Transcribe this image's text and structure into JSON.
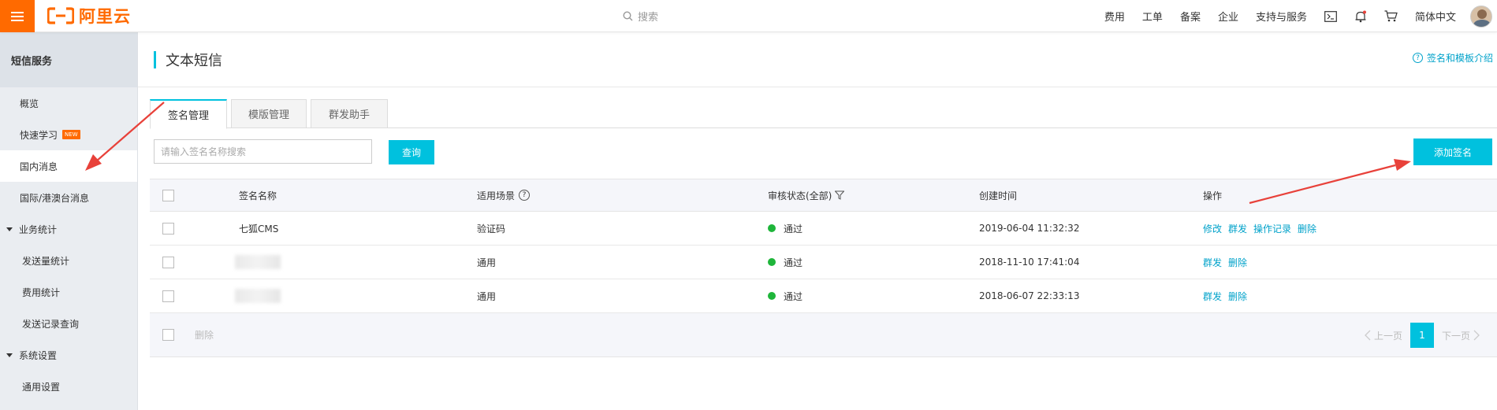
{
  "topbar": {
    "brand": "阿里云",
    "search_text": "搜索",
    "nav": [
      "费用",
      "工单",
      "备案",
      "企业",
      "支持与服务"
    ],
    "language": "简体中文"
  },
  "sidebar": {
    "title": "短信服务",
    "items": [
      {
        "label": "概览"
      },
      {
        "label": "快速学习",
        "badge": "NEW"
      },
      {
        "label": "国内消息",
        "active": true
      },
      {
        "label": "国际/港澳台消息"
      }
    ],
    "groups": [
      {
        "label": "业务统计",
        "children": [
          "发送量统计",
          "费用统计",
          "发送记录查询"
        ]
      },
      {
        "label": "系统设置",
        "children": [
          "通用设置"
        ]
      }
    ]
  },
  "main": {
    "title": "文本短信",
    "help_link": "签名和模板介绍",
    "tabs": [
      "签名管理",
      "模版管理",
      "群发助手"
    ],
    "search_placeholder": "请输入签名名称搜索",
    "query_button": "查询",
    "add_button": "添加签名",
    "table": {
      "headers": [
        "签名名称",
        "适用场景",
        "审核状态(全部)",
        "创建时间",
        "操作"
      ],
      "rows": [
        {
          "name": "七狐CMS",
          "scene": "验证码",
          "status": "通过",
          "created": "2019-06-04 11:32:32",
          "ops": [
            "修改",
            "群发",
            "操作记录",
            "删除"
          ]
        },
        {
          "name": "",
          "scene": "通用",
          "status": "通过",
          "created": "2018-11-10 17:41:04",
          "ops": [
            "群发",
            "删除"
          ]
        },
        {
          "name": "",
          "scene": "通用",
          "status": "通过",
          "created": "2018-06-07 22:33:13",
          "ops": [
            "群发",
            "删除"
          ]
        }
      ],
      "footer_delete": "删除",
      "pager": {
        "prev": "上一页",
        "current": "1",
        "next": "下一页"
      }
    }
  },
  "colors": {
    "brand": "#ff6a00",
    "accent": "#00c1de",
    "link": "#00a2ca",
    "success": "#1eb53a",
    "annotation_arrow": "#e8413a"
  }
}
